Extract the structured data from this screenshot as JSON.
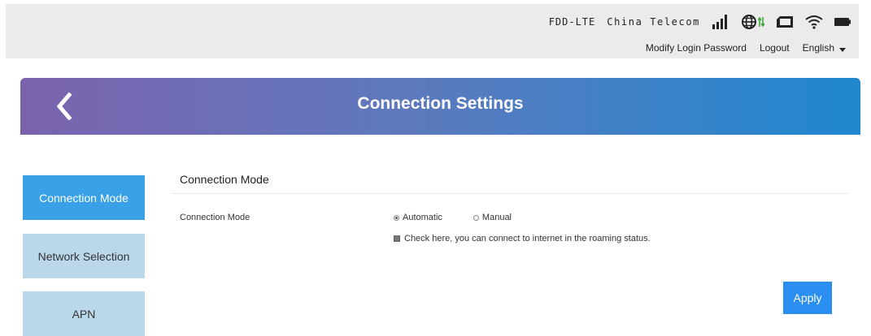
{
  "header": {
    "network_type": "FDD-LTE",
    "carrier": "China Telecom",
    "links": {
      "modify_password": "Modify Login Password",
      "logout": "Logout",
      "language": "English"
    },
    "status_icons": [
      "signal-strength-icon",
      "globe-network-icon",
      "data-transfer-arrows-icon",
      "sim-card-icon",
      "wifi-icon",
      "battery-icon"
    ]
  },
  "banner": {
    "title": "Connection Settings",
    "back_icon": "chevron-left-icon"
  },
  "sidebar": {
    "items": [
      {
        "label": "Connection Mode",
        "active": true
      },
      {
        "label": "Network Selection",
        "active": false
      },
      {
        "label": "APN",
        "active": false
      }
    ]
  },
  "main": {
    "section_title": "Connection Mode",
    "field_label": "Connection Mode",
    "options": [
      {
        "label": "Automatic",
        "selected": true
      },
      {
        "label": "Manual",
        "selected": false
      }
    ],
    "roaming_text": "Check here, you can connect to internet in the roaming status.",
    "roaming_checked": true,
    "apply_label": "Apply"
  },
  "colors": {
    "banner_start": "#7b62ad",
    "banner_end": "#1f88cf",
    "active_tab": "#3aa0e8",
    "inactive_tab": "#bbd7ea",
    "apply_button": "#2a8ff0"
  }
}
